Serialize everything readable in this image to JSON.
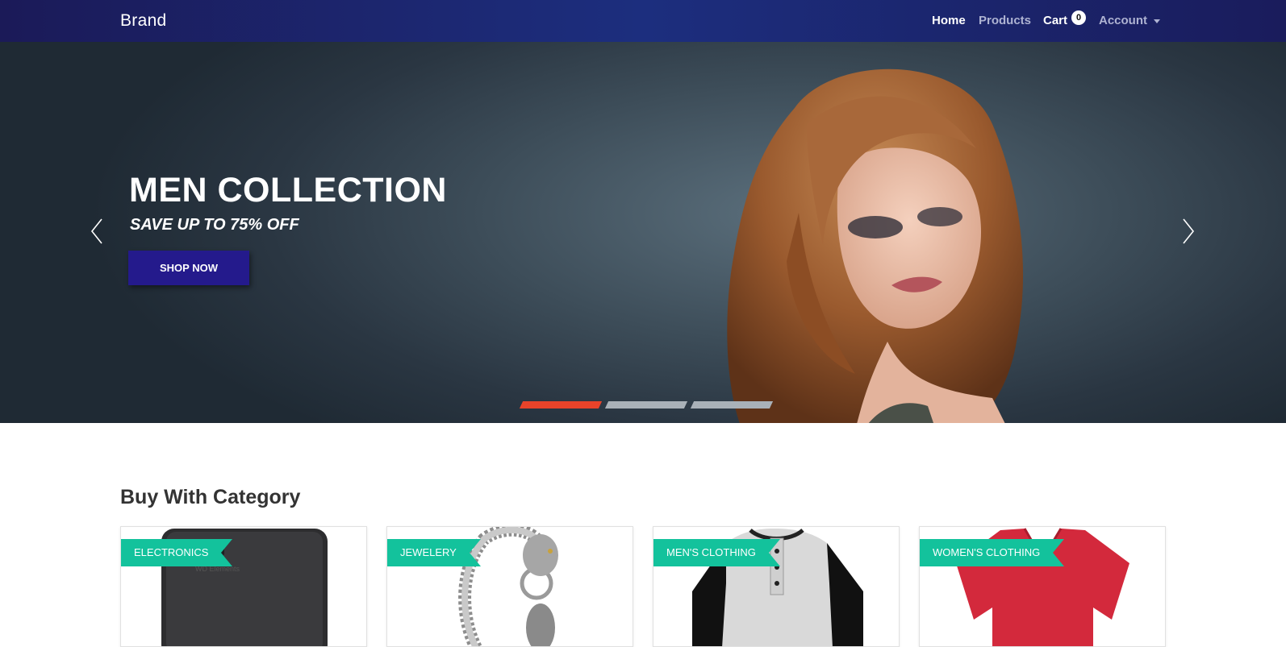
{
  "navbar": {
    "brand": "Brand",
    "links": [
      {
        "label": "Home",
        "active": true
      },
      {
        "label": "Products",
        "active": false
      },
      {
        "label": "Cart",
        "active": true
      },
      {
        "label": "Account",
        "active": false
      }
    ],
    "cart_count": "0"
  },
  "hero": {
    "title": "MEN COLLECTION",
    "subtitle": "SAVE UP TO 75% OFF",
    "button": "SHOP NOW",
    "slides": 3,
    "active_slide": 1,
    "indicator_active_color": "#e8432a",
    "indicator_inactive_color": "#a9b1b8"
  },
  "categories": {
    "title": "Buy With Category",
    "items": [
      {
        "label": "ELECTRONICS",
        "image": "external-hard-drive"
      },
      {
        "label": "JEWELERY",
        "image": "silver-bracelet"
      },
      {
        "label": "MEN'S CLOTHING",
        "image": "raglan-henley-shirt"
      },
      {
        "label": "WOMEN'S CLOTHING",
        "image": "red-v-neck-shirt"
      }
    ],
    "tag_color": "#13c29c"
  },
  "colors": {
    "navbar": "#1c2e7e",
    "button": "#241a8c",
    "accent": "#e8432a"
  }
}
